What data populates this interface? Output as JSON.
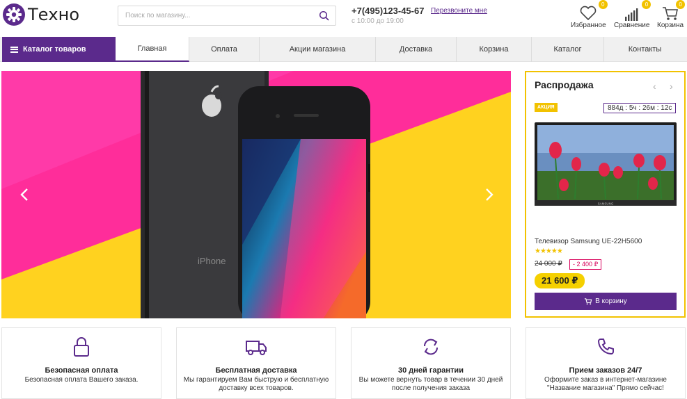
{
  "brand": {
    "name": "Техно",
    "accent": "#5b2a8c",
    "highlight": "#f2c200"
  },
  "search": {
    "placeholder": "Поиск по магазину..."
  },
  "contact": {
    "phone": "+7(495)123-45-67",
    "callback": "Перезвоните мне",
    "hours": "с 10:00 до 19:00"
  },
  "header_icons": [
    {
      "icon": "heart-icon",
      "label": "Избранное",
      "count": "0"
    },
    {
      "icon": "bar-chart-icon",
      "label": "Сравнение",
      "count": "0"
    },
    {
      "icon": "cart-icon",
      "label": "Корзина",
      "count": "0"
    }
  ],
  "nav": {
    "catalog_label": "Каталог товаров",
    "items": [
      "Главная",
      "Оплата",
      "Акции магазина",
      "Доставка",
      "Корзина",
      "Каталог",
      "Контакты"
    ],
    "active": "Главная"
  },
  "banner": {
    "product": "iPhone"
  },
  "sale": {
    "title": "Распродажа",
    "badge": "АКЦИЯ",
    "timer": "884д : 5ч : 26м : 12с",
    "product_name": "Телевизор Samsung UE-22H5600",
    "tv_brand": "SAMSUNG",
    "rating": 5,
    "old_price": "24 000 ₽",
    "discount": "- 2 400 ₽",
    "price": "21 600 ₽",
    "cart_label": "В корзину"
  },
  "features": [
    {
      "icon": "lock-icon",
      "title": "Безопасная оплата",
      "desc": "Безопасная оплата Вашего заказа."
    },
    {
      "icon": "truck-icon",
      "title": "Бесплатная доставка",
      "desc": "Мы гарантируем Вам быструю и бесплатную доставку всех товаров."
    },
    {
      "icon": "refresh-icon",
      "title": "30 дней гарантии",
      "desc": "Вы можете вернуть товар в течении 30 дней после получения заказа"
    },
    {
      "icon": "phone-icon",
      "title": "Прием заказов 24/7",
      "desc": "Оформите заказ в интернет-магазине \"Название магазина\" Прямо сейчас!"
    }
  ]
}
